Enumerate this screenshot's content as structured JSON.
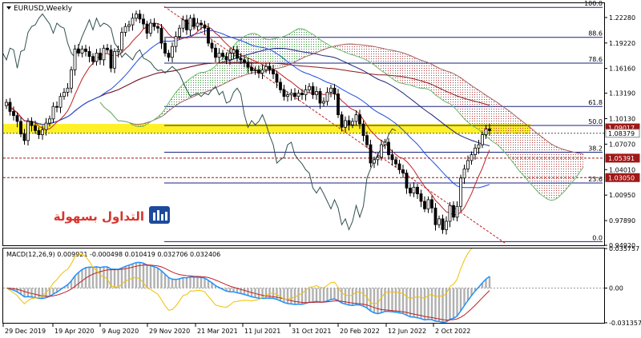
{
  "chart_data": [
    {
      "type": "candlestick",
      "title": "EURUSD,Weekly",
      "y_ticks": [
        "1.22280",
        "1.19220",
        "1.16160",
        "1.13190",
        "1.10130",
        "1.07070",
        "1.04010",
        "1.00950",
        "0.97890",
        "0.94920"
      ],
      "ylim": [
        0.9492,
        1.24
      ],
      "x_ticks": [
        "29 Dec 2019",
        "19 Apr 2020",
        "9 Aug 2020",
        "29 Nov 2020",
        "21 Mar 2021",
        "11 Jul 2021",
        "31 Oct 2021",
        "20 Feb 2022",
        "12 Jun 2022",
        "2 Oct 2022"
      ],
      "fibonacci": [
        {
          "level": "100.0",
          "price": 1.235
        },
        {
          "level": "88.6",
          "price": 1.199
        },
        {
          "level": "78.6",
          "price": 1.168
        },
        {
          "level": "61.8",
          "price": 1.116
        },
        {
          "level": "50.0",
          "price": 1.0932
        },
        {
          "level": "38.2",
          "price": 1.061
        },
        {
          "level": "23.6",
          "price": 1.024
        },
        {
          "level": "0.0",
          "price": 0.9536
        }
      ],
      "price_tags": [
        {
          "label": "1.09017",
          "price": 1.0902,
          "color": "#a01818"
        },
        {
          "label": "1.08379",
          "price": 1.0838,
          "color": "#ffffff"
        },
        {
          "label": "1.05391",
          "price": 1.0539,
          "color": "#a01818"
        },
        {
          "label": "1.03050",
          "price": 1.0305,
          "color": "#a01818"
        }
      ],
      "highlight_zone": [
        1.084,
        1.095
      ],
      "series_close": [
        1.121,
        1.11,
        1.105,
        1.098,
        1.083,
        1.075,
        1.098,
        1.093,
        1.087,
        1.082,
        1.088,
        1.096,
        1.101,
        1.116,
        1.115,
        1.128,
        1.133,
        1.138,
        1.16,
        1.185,
        1.18,
        1.185,
        1.182,
        1.176,
        1.17,
        1.18,
        1.172,
        1.186,
        1.184,
        1.162,
        1.182,
        1.184,
        1.205,
        1.212,
        1.214,
        1.222,
        1.227,
        1.221,
        1.215,
        1.204,
        1.216,
        1.212,
        1.21,
        1.192,
        1.18,
        1.175,
        1.188,
        1.2,
        1.21,
        1.22,
        1.208,
        1.222,
        1.212,
        1.216,
        1.214,
        1.21,
        1.192,
        1.186,
        1.175,
        1.18,
        1.176,
        1.172,
        1.18,
        1.184,
        1.174,
        1.172,
        1.169,
        1.163,
        1.159,
        1.16,
        1.156,
        1.16,
        1.164,
        1.16,
        1.155,
        1.145,
        1.136,
        1.128,
        1.13,
        1.132,
        1.128,
        1.132,
        1.13,
        1.136,
        1.14,
        1.13,
        1.134,
        1.12,
        1.122,
        1.133,
        1.138,
        1.131,
        1.106,
        1.091,
        1.099,
        1.094,
        1.098,
        1.106,
        1.095,
        1.081,
        1.07,
        1.048,
        1.052,
        1.055,
        1.07,
        1.073,
        1.058,
        1.052,
        1.047,
        1.04,
        1.036,
        1.018,
        1.012,
        1.019,
        1.011,
        1.002,
        0.993,
        1.004,
        0.994,
        0.974,
        0.981,
        0.968,
        0.978,
        0.997,
        0.983,
        0.996,
        1.03,
        1.041,
        1.051,
        1.058,
        1.066,
        1.07,
        1.082,
        1.089,
        1.087
      ],
      "macd": {
        "label": "MACD(12,26,9) 0.009921 -0.000498 0.010419 0.032706 0.032406",
        "y_ticks": [
          "0.035757",
          "0.00",
          "-0.031357"
        ],
        "ylim": [
          -0.0314,
          0.0358
        ]
      }
    }
  ],
  "logo": {
    "text": "التداول بسهولة"
  }
}
